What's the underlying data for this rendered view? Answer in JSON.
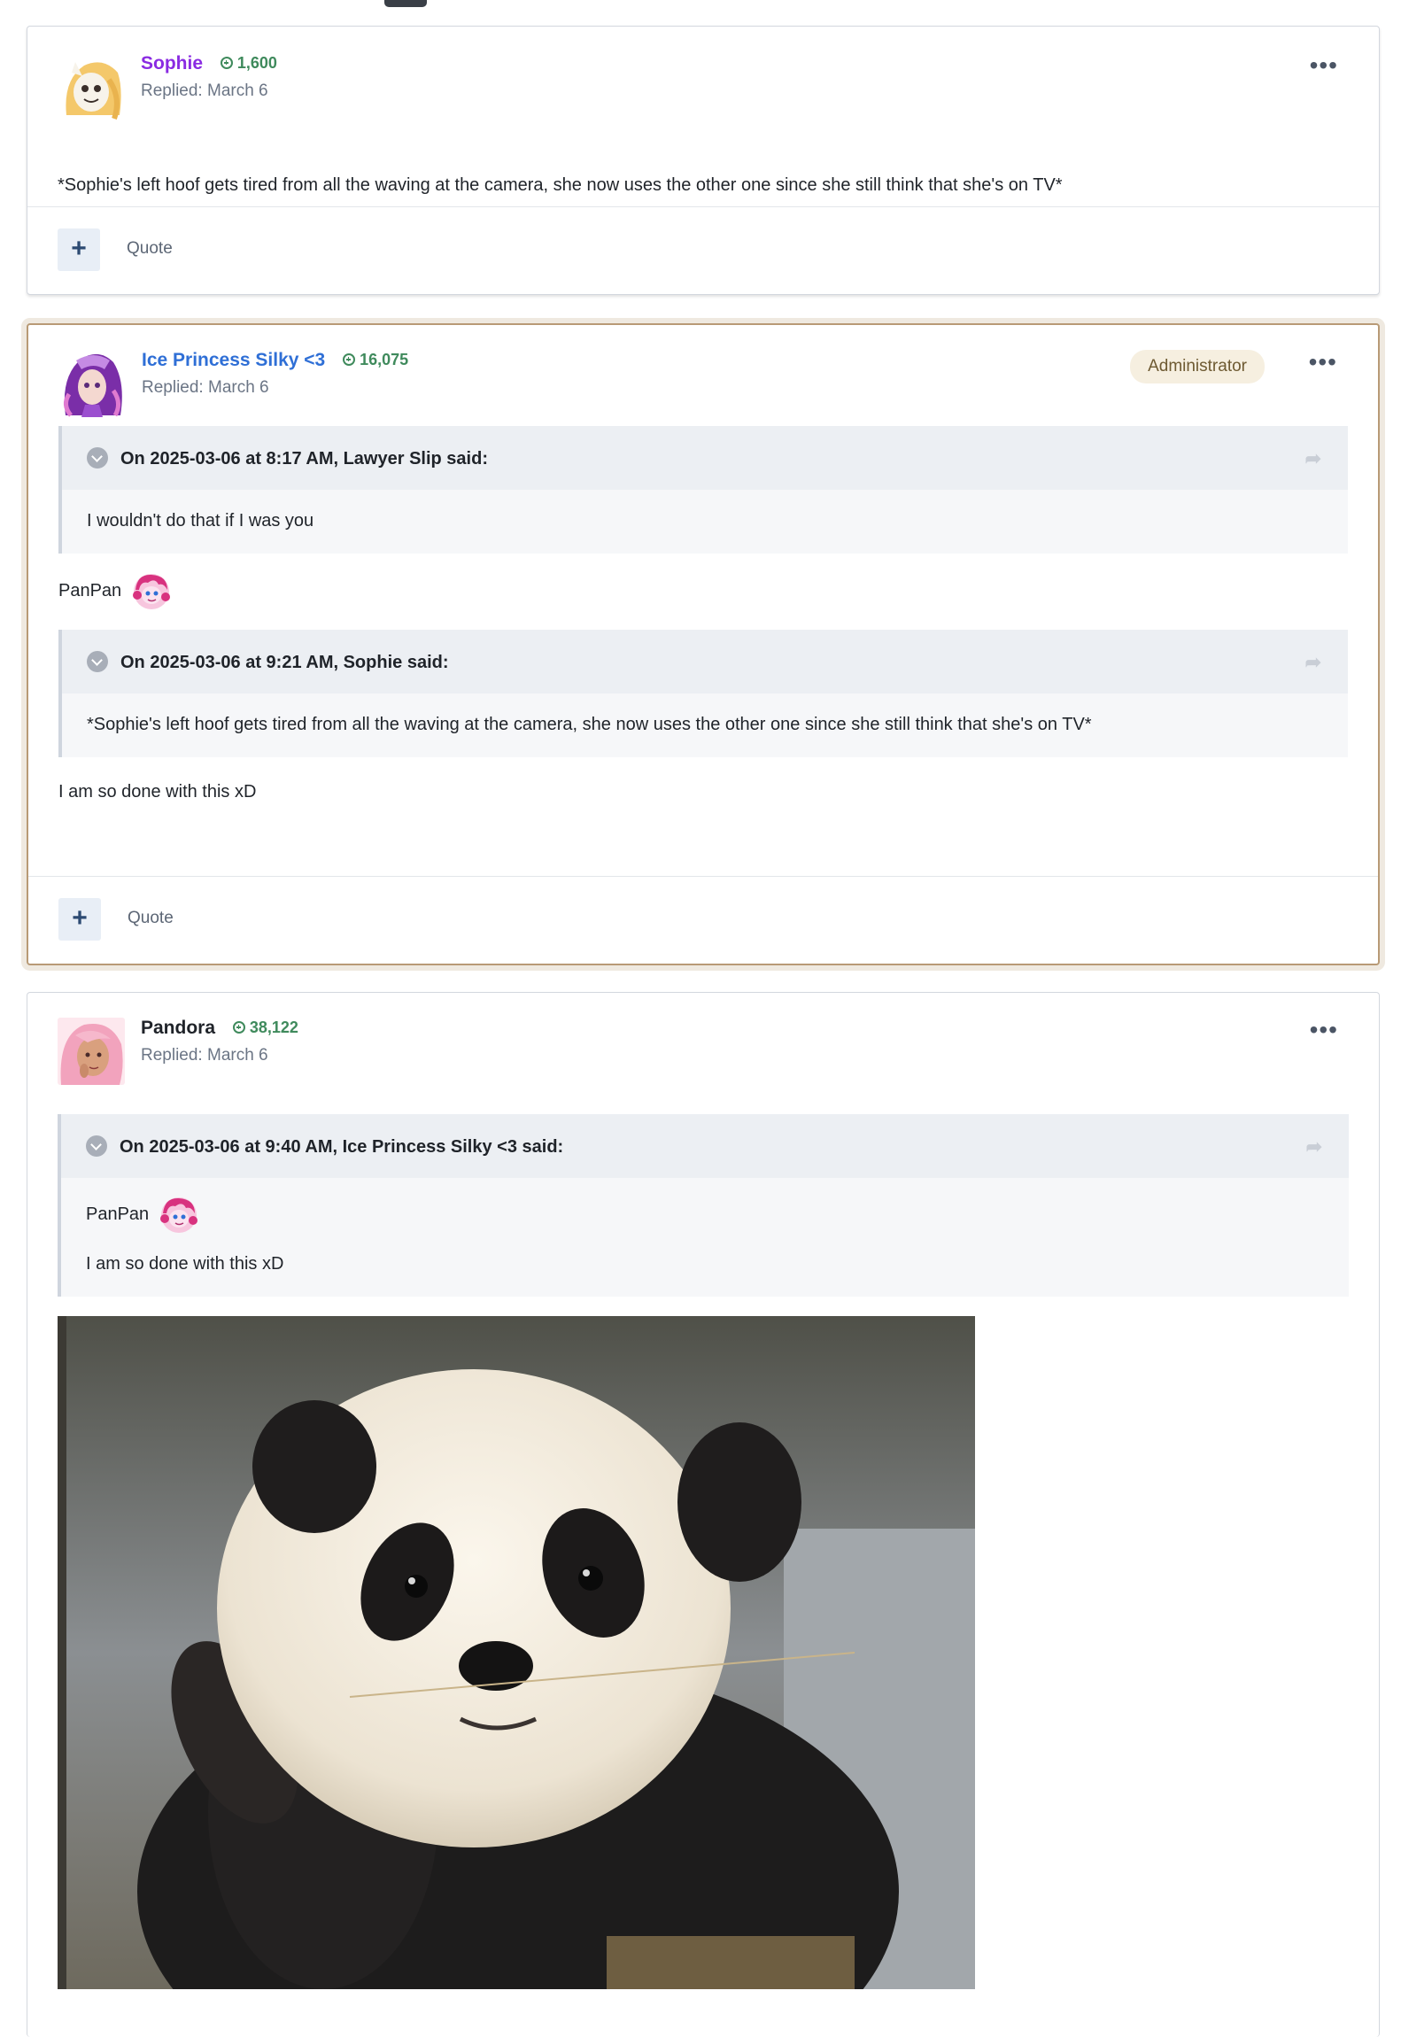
{
  "posts": [
    {
      "author": "Sophie",
      "author_color": "#8a2be2",
      "reputation": "1,600",
      "replied": "Replied: March 6",
      "text": "*Sophie's left hoof gets tired from all the waving at the camera, she now uses the other one since she still think that she's on TV*",
      "footer": {
        "quote_label": "Quote",
        "plus": "+"
      }
    },
    {
      "author": "Ice Princess Silky <3",
      "author_color": "#2f6fd6",
      "reputation": "16,075",
      "replied": "Replied: March 6",
      "badge": "Administrator",
      "quote1": {
        "title": "On 2025-03-06 at 8:17 AM, Lawyer Slip said:",
        "text": "I wouldn't do that if I was you"
      },
      "line1": "PanPan",
      "quote2": {
        "title": "On 2025-03-06 at 9:21 AM, Sophie said:",
        "text": "*Sophie's left hoof gets tired from all the waving at the camera, she now uses the other one since she still think that she's on TV*"
      },
      "line2": "I am so done with this xD",
      "footer": {
        "quote_label": "Quote",
        "plus": "+"
      }
    },
    {
      "author": "Pandora",
      "author_color": "#1f2329",
      "reputation": "38,122",
      "replied": "Replied: March 6",
      "quote1": {
        "title": "On 2025-03-06 at 9:40 AM, Ice Princess Silky <3 said:",
        "line1": "PanPan",
        "line2": "I am so done with this xD"
      }
    }
  ],
  "more_icon": "ellipsis-icon",
  "share_icon": "share-arrow-icon"
}
